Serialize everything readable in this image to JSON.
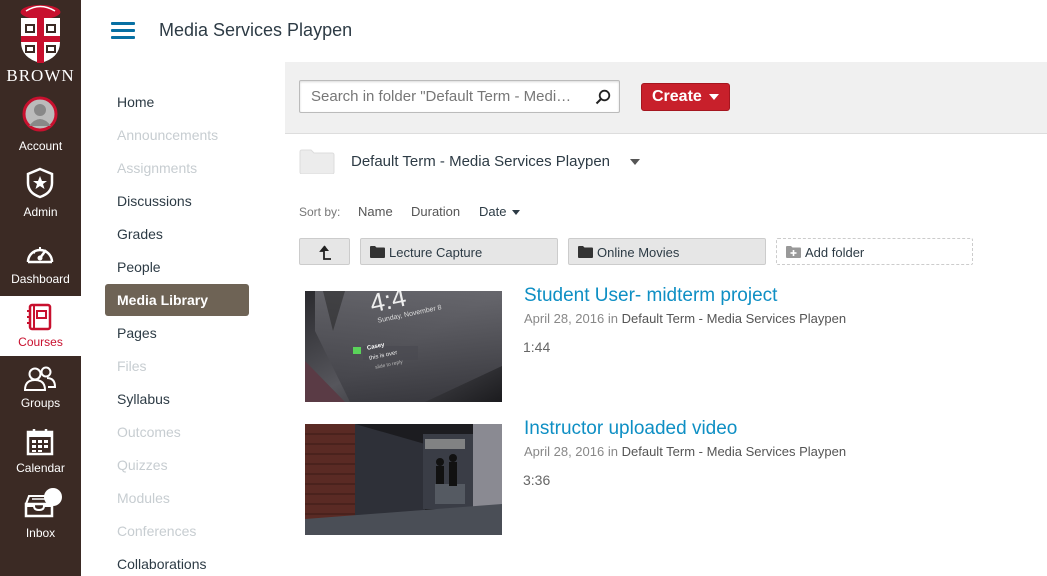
{
  "brand": {
    "wordmark": "BROWN"
  },
  "global_nav": [
    {
      "key": "account",
      "label": "Account",
      "icon": "account-avatar-icon"
    },
    {
      "key": "admin",
      "label": "Admin",
      "icon": "shield-star-icon"
    },
    {
      "key": "dashboard",
      "label": "Dashboard",
      "icon": "speedometer-icon"
    },
    {
      "key": "courses",
      "label": "Courses",
      "icon": "book-icon",
      "active": true
    },
    {
      "key": "groups",
      "label": "Groups",
      "icon": "users-icon"
    },
    {
      "key": "calendar",
      "label": "Calendar",
      "icon": "calendar-icon"
    },
    {
      "key": "inbox",
      "label": "Inbox",
      "icon": "inbox-icon"
    }
  ],
  "header": {
    "course_title": "Media Services Playpen"
  },
  "course_nav": [
    {
      "label": "Home",
      "state": "enabled"
    },
    {
      "label": "Announcements",
      "state": "disabled"
    },
    {
      "label": "Assignments",
      "state": "disabled"
    },
    {
      "label": "Discussions",
      "state": "enabled"
    },
    {
      "label": "Grades",
      "state": "enabled"
    },
    {
      "label": "People",
      "state": "enabled"
    },
    {
      "label": "Media Library",
      "state": "active"
    },
    {
      "label": "Pages",
      "state": "enabled"
    },
    {
      "label": "Files",
      "state": "disabled"
    },
    {
      "label": "Syllabus",
      "state": "enabled"
    },
    {
      "label": "Outcomes",
      "state": "disabled"
    },
    {
      "label": "Quizzes",
      "state": "disabled"
    },
    {
      "label": "Modules",
      "state": "disabled"
    },
    {
      "label": "Conferences",
      "state": "disabled"
    },
    {
      "label": "Collaborations",
      "state": "enabled"
    }
  ],
  "toolbar": {
    "search_placeholder": "Search in folder \"Default Term - Medi…",
    "create_label": "Create"
  },
  "folder": {
    "name": "Default Term - Media Services Playpen"
  },
  "sort": {
    "label": "Sort by:",
    "name": "Name",
    "duration": "Duration",
    "date": "Date"
  },
  "folder_buttons": {
    "lecture_capture": "Lecture Capture",
    "online_movies": "Online Movies",
    "add_folder": "Add folder"
  },
  "media": [
    {
      "title": "Student User- midterm project",
      "date": "April 28, 2016",
      "in_word": "in",
      "location": "Default Term - Media Services Playpen",
      "duration": "1:44",
      "thumb_text": {
        "time": "4:4",
        "date": "Sunday, November 8",
        "name": "Casey",
        "msg1": "this is over",
        "msg2": "slide to reply"
      }
    },
    {
      "title": "Instructor uploaded video",
      "date": "April 28, 2016",
      "in_word": "in",
      "location": "Default Term - Media Services Playpen",
      "duration": "3:36"
    }
  ],
  "colors": {
    "nav_bg": "#3b2a24",
    "active_red": "#c8102e",
    "link_blue": "#0e8fc4",
    "active_course_item": "#6e6355",
    "create_red": "#c8202b"
  }
}
